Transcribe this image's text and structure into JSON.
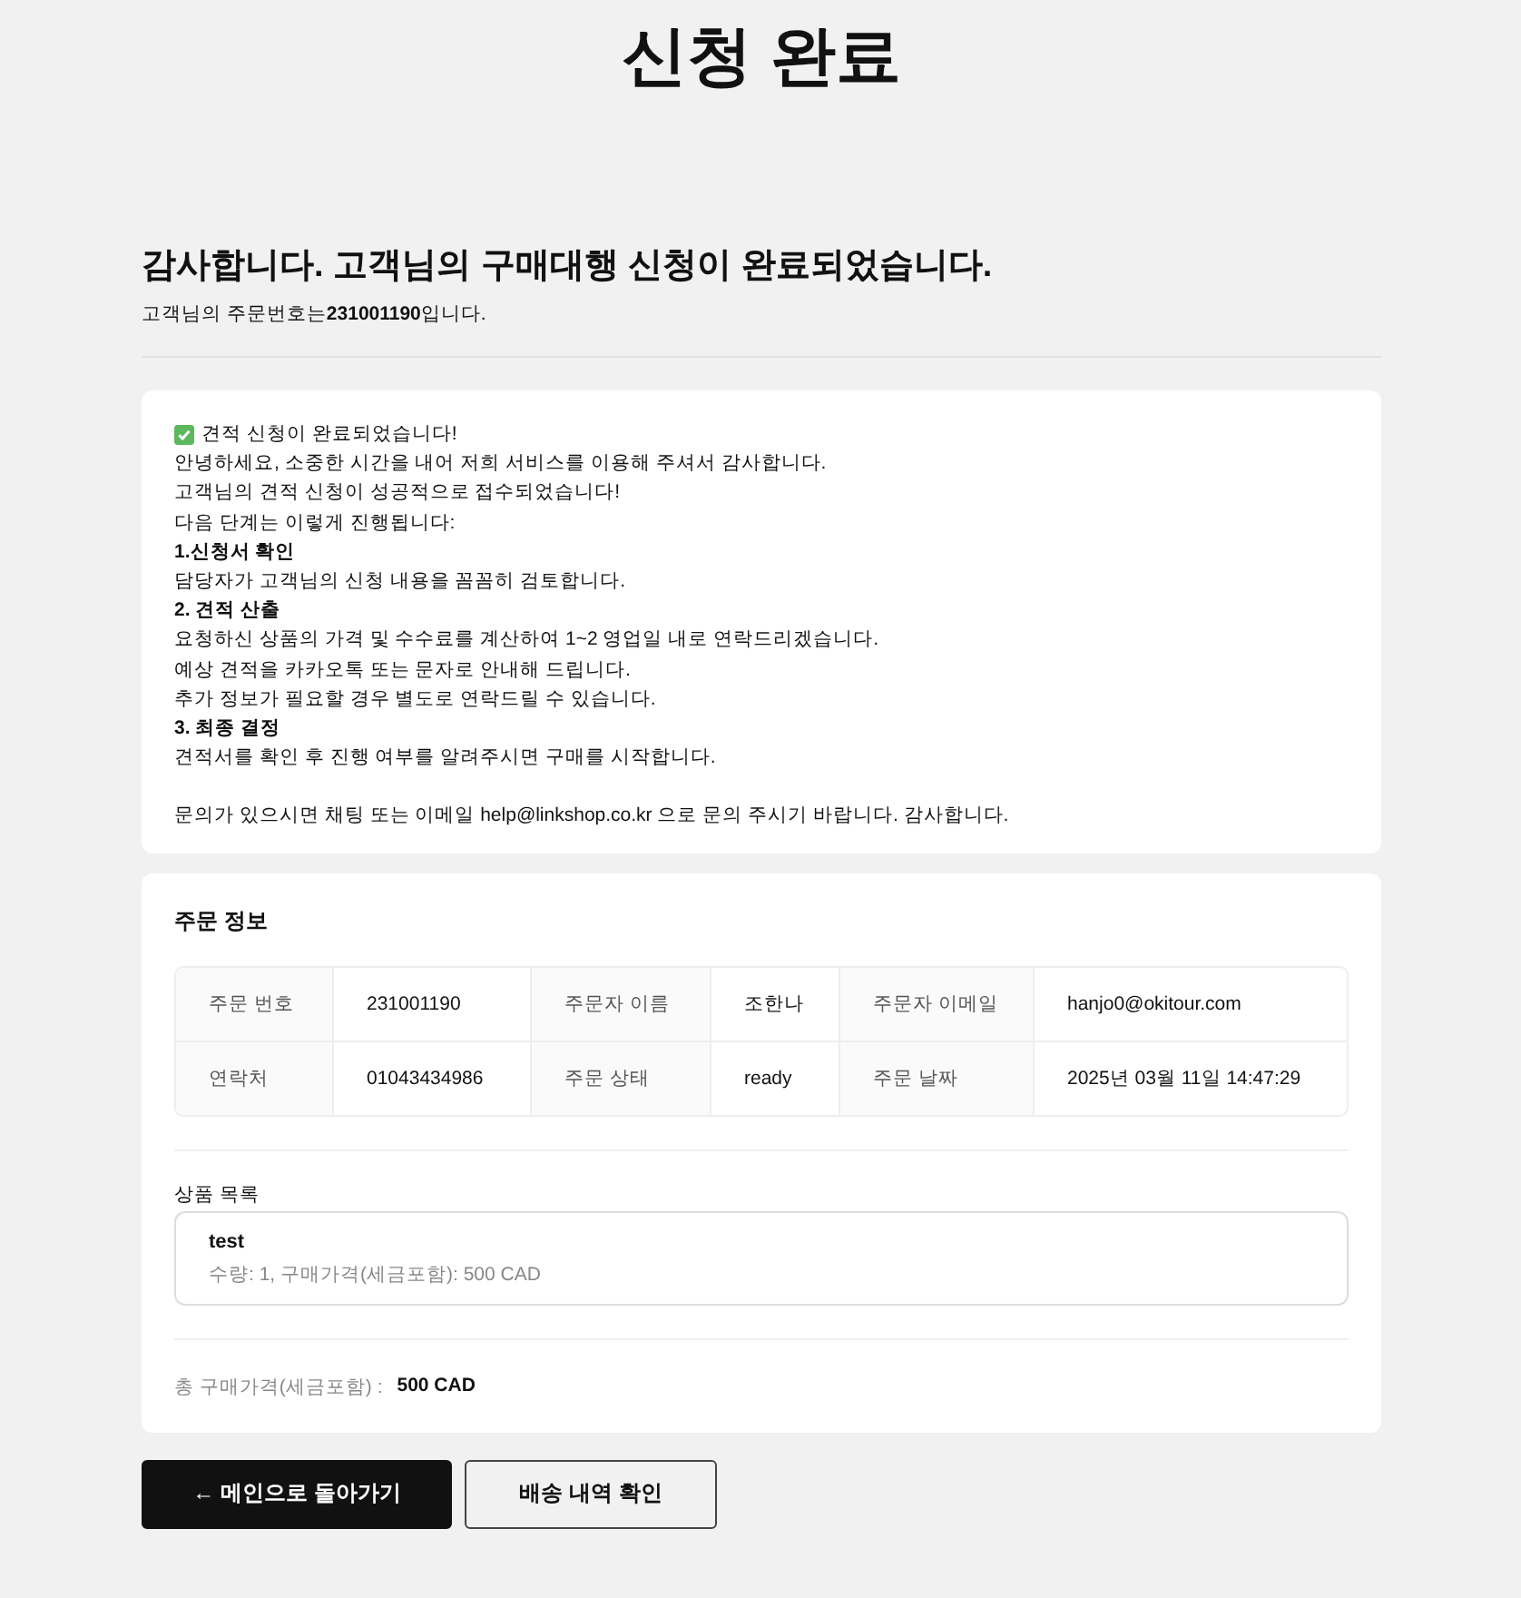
{
  "page_title": "신청 완료",
  "thanks": {
    "heading": "감사합니다. 고객님의 구매대행 신청이 완료되었습니다.",
    "order_note": "고객님의 주문번호는**231001190**입니다."
  },
  "message": [
    {
      "kind": "success",
      "text": "견적 신청이 완료되었습니다!"
    },
    {
      "kind": "text",
      "text": "안녕하세요, 소중한 시간을 내어 저희 서비스를 이용해 주셔서 감사합니다."
    },
    {
      "kind": "text",
      "text": "고객님의 견적 신청이 성공적으로 접수되었습니다!"
    },
    {
      "kind": "text",
      "text": "다음 단계는 이렇게 진행됩니다:"
    },
    {
      "kind": "step",
      "text": "1.신청서 확인"
    },
    {
      "kind": "text",
      "text": "담당자가 고객님의 신청 내용을 꼼꼼히 검토합니다."
    },
    {
      "kind": "step",
      "text": "2. 견적 산출"
    },
    {
      "kind": "text",
      "text": "요청하신 상품의 가격 및 수수료를 계산하여 1~2 영업일 내로 연락드리겠습니다."
    },
    {
      "kind": "text",
      "text": "예상 견적을 카카오톡 또는 문자로 안내해 드립니다."
    },
    {
      "kind": "text",
      "text": "추가 정보가 필요할 경우 별도로 연락드릴 수 있습니다."
    },
    {
      "kind": "step",
      "text": "3. 최종 결정"
    },
    {
      "kind": "text",
      "text": "견적서를 확인 후 진행 여부를 알려주시면 구매를 시작합니다."
    },
    {
      "kind": "closing",
      "text": "문의가 있으시면 채팅 또는 이메일 help@linkshop.co.kr 으로 문의 주시기 바랍니다. 감사합니다."
    }
  ],
  "order_info": {
    "title": "주문 정보",
    "rows": [
      [
        {
          "label": "주문 번호",
          "value": "231001190"
        },
        {
          "label": "주문자 이름",
          "value": "조한나"
        },
        {
          "label": "주문자 이메일",
          "value": "hanjo0@okitour.com"
        }
      ],
      [
        {
          "label": "연락처",
          "value": "01043434986"
        },
        {
          "label": "주문 상태",
          "value": "ready"
        },
        {
          "label": "주문 날짜",
          "value": "2025년 03월 11일 14:47:29"
        }
      ]
    ],
    "products_title": "상품 목록",
    "products": [
      {
        "name": "test",
        "detail": "수량: 1, 구매가격(세금포함): 500 CAD"
      }
    ],
    "total_label": "총 구매가격(세금포함) :",
    "total_value": "500 CAD"
  },
  "buttons": [
    {
      "kind": "primary",
      "label": "← 메인으로 돌아가기"
    },
    {
      "kind": "secondary",
      "label": "배송 내역 확인"
    }
  ]
}
